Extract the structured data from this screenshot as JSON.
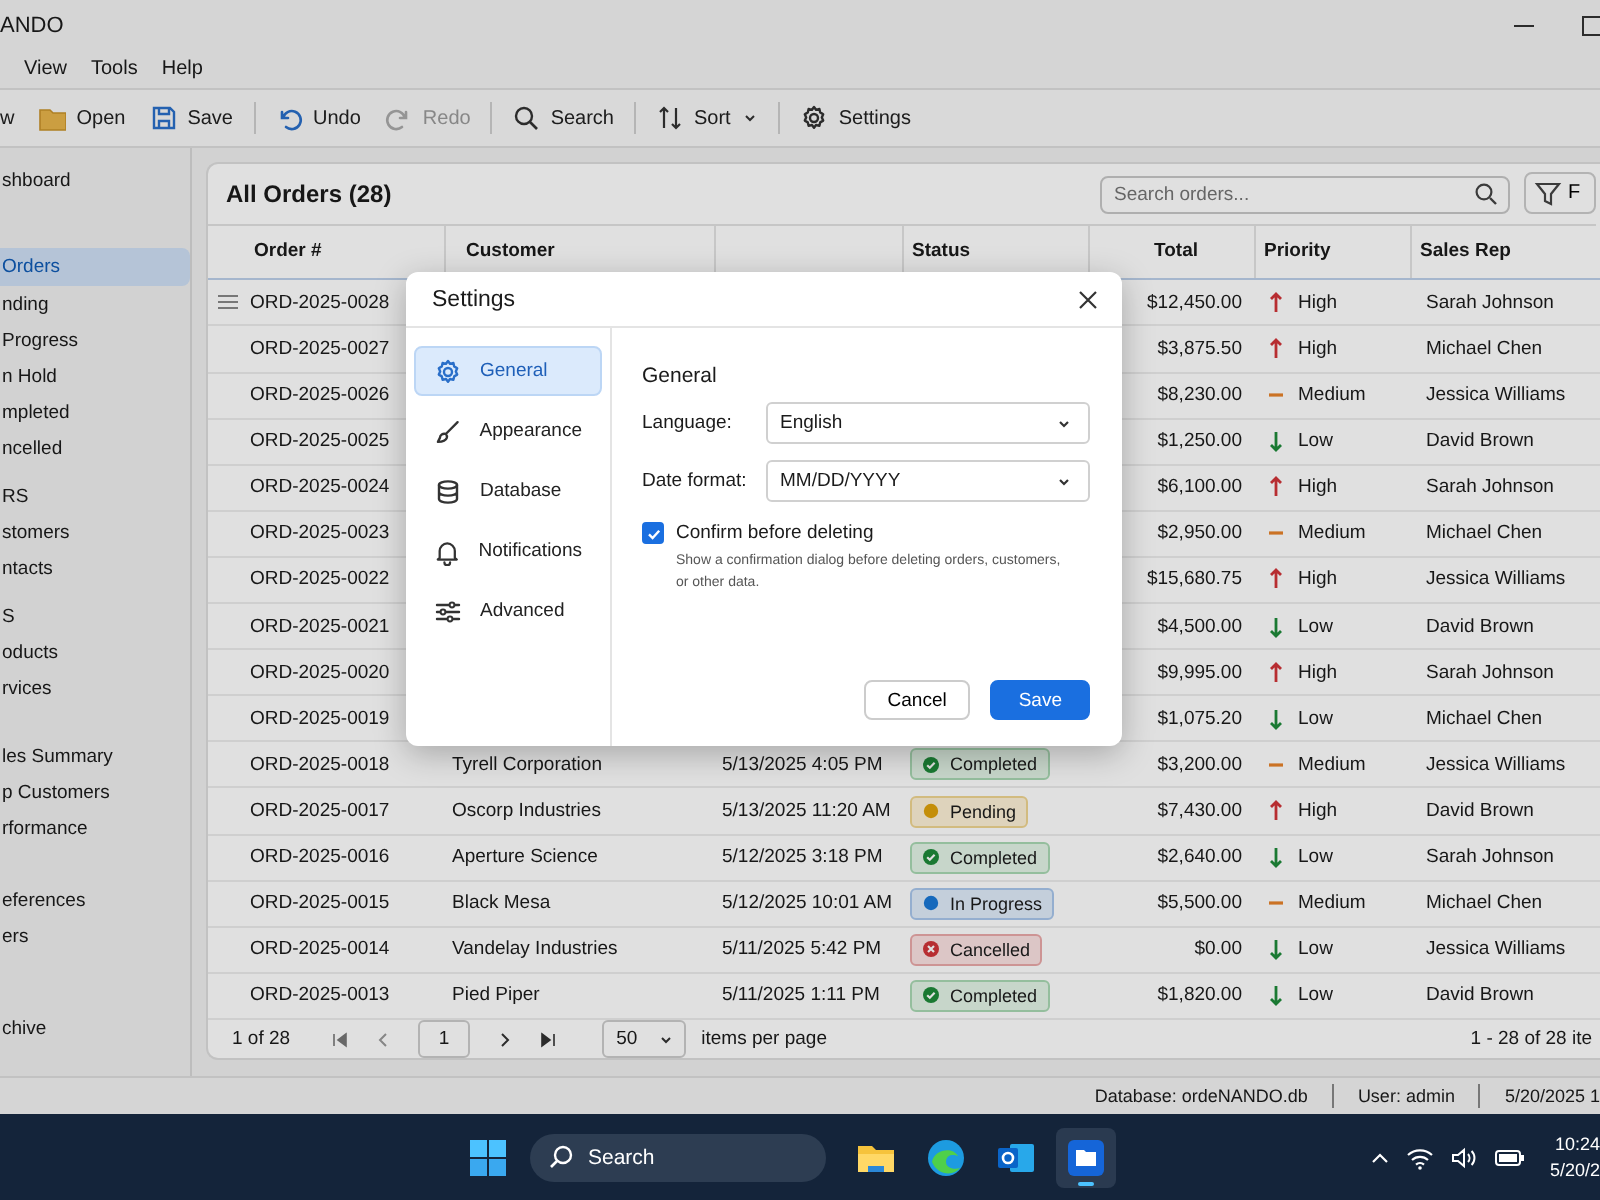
{
  "window": {
    "title": "ANDO"
  },
  "menu": [
    "View",
    "Tools",
    "Help"
  ],
  "toolbar": [
    {
      "items": [
        {
          "label": "w",
          "disabled": false
        },
        {
          "label": "Open",
          "disabled": false
        },
        {
          "label": "Save",
          "disabled": false
        }
      ]
    },
    {
      "items": [
        {
          "label": "Undo",
          "disabled": false
        },
        {
          "label": "Redo",
          "disabled": true
        }
      ]
    },
    {
      "items": [
        {
          "label": "Search",
          "disabled": false
        }
      ]
    },
    {
      "items": [
        {
          "label": "Sort",
          "disabled": false,
          "has_menu": true
        }
      ]
    },
    {
      "items": [
        {
          "label": "Settings",
          "disabled": false
        }
      ]
    }
  ],
  "sidebar": {
    "groups": [
      {
        "items": [
          {
            "label": "shboard",
            "selected": false
          }
        ]
      },
      {
        "items": [
          {
            "label": "Orders",
            "selected": true
          },
          {
            "label": "nding",
            "selected": false
          },
          {
            "label": "Progress",
            "selected": false
          },
          {
            "label": "n Hold",
            "selected": false
          },
          {
            "label": "mpleted",
            "selected": false
          },
          {
            "label": "ncelled",
            "selected": false
          }
        ]
      },
      {
        "items": [
          {
            "label": "RS",
            "selected": false
          },
          {
            "label": "stomers",
            "selected": false
          },
          {
            "label": "ntacts",
            "selected": false
          }
        ]
      },
      {
        "items": [
          {
            "label": "S",
            "selected": false
          },
          {
            "label": "oducts",
            "selected": false
          },
          {
            "label": "rvices",
            "selected": false
          }
        ]
      },
      {
        "items": [
          {
            "label": "les Summary",
            "selected": false
          },
          {
            "label": "p Customers",
            "selected": false
          },
          {
            "label": "rformance",
            "selected": false
          }
        ]
      },
      {
        "items": [
          {
            "label": "eferences",
            "selected": false
          },
          {
            "label": "ers",
            "selected": false
          }
        ]
      },
      {
        "items": [
          {
            "label": "chive",
            "selected": false
          }
        ]
      }
    ]
  },
  "orders": {
    "title": "All Orders (28)",
    "search": {
      "placeholder": "Search orders..."
    },
    "filter_label": "F",
    "header": {
      "order": "Order #",
      "customer": "Customer",
      "status": "Status",
      "total": "Total",
      "priority": "Priority",
      "rep": "Sales Rep"
    },
    "rows": [
      {
        "order": "ORD-2025-0028",
        "show_handle": true,
        "total": "$12,450.00",
        "priority": {
          "label": "High",
          "kind": "high"
        },
        "rep": "Sarah Johnson"
      },
      {
        "order": "ORD-2025-0027",
        "show_handle": false,
        "total": "$3,875.50",
        "priority": {
          "label": "High",
          "kind": "high"
        },
        "rep": "Michael Chen"
      },
      {
        "order": "ORD-2025-0026",
        "show_handle": false,
        "total": "$8,230.00",
        "priority": {
          "label": "Medium",
          "kind": "medium"
        },
        "rep": "Jessica Williams"
      },
      {
        "order": "ORD-2025-0025",
        "show_handle": false,
        "total": "$1,250.00",
        "priority": {
          "label": "Low",
          "kind": "low"
        },
        "rep": "David Brown"
      },
      {
        "order": "ORD-2025-0024",
        "show_handle": false,
        "total": "$6,100.00",
        "priority": {
          "label": "High",
          "kind": "high"
        },
        "rep": "Sarah Johnson"
      },
      {
        "order": "ORD-2025-0023",
        "show_handle": false,
        "total": "$2,950.00",
        "priority": {
          "label": "Medium",
          "kind": "medium"
        },
        "rep": "Michael Chen"
      },
      {
        "order": "ORD-2025-0022",
        "show_handle": false,
        "total": "$15,680.75",
        "priority": {
          "label": "High",
          "kind": "high"
        },
        "rep": "Jessica Williams"
      },
      {
        "order": "ORD-2025-0021",
        "show_handle": false,
        "total": "$4,500.00",
        "priority": {
          "label": "Low",
          "kind": "low"
        },
        "rep": "David Brown"
      },
      {
        "order": "ORD-2025-0020",
        "show_handle": false,
        "total": "$9,995.00",
        "priority": {
          "label": "High",
          "kind": "high"
        },
        "rep": "Sarah Johnson"
      },
      {
        "order": "ORD-2025-0019",
        "show_handle": false,
        "total": "$1,075.20",
        "priority": {
          "label": "Low",
          "kind": "low"
        },
        "rep": "Michael Chen"
      },
      {
        "order": "ORD-2025-0018",
        "show_handle": false,
        "customer": "Tyrell Corporation",
        "date": "5/13/2025 4:05 PM",
        "status": {
          "label": "Completed",
          "kind": "completed"
        },
        "total": "$3,200.00",
        "priority": {
          "label": "Medium",
          "kind": "medium"
        },
        "rep": "Jessica Williams"
      },
      {
        "order": "ORD-2025-0017",
        "show_handle": false,
        "customer": "Oscorp Industries",
        "date": "5/13/2025 11:20 AM",
        "status": {
          "label": "Pending",
          "kind": "pending"
        },
        "total": "$7,430.00",
        "priority": {
          "label": "High",
          "kind": "high"
        },
        "rep": "David Brown"
      },
      {
        "order": "ORD-2025-0016",
        "show_handle": false,
        "customer": "Aperture Science",
        "date": "5/12/2025 3:18 PM",
        "status": {
          "label": "Completed",
          "kind": "completed"
        },
        "total": "$2,640.00",
        "priority": {
          "label": "Low",
          "kind": "low"
        },
        "rep": "Sarah Johnson"
      },
      {
        "order": "ORD-2025-0015",
        "show_handle": false,
        "customer": "Black Mesa",
        "date": "5/12/2025 10:01 AM",
        "status": {
          "label": "In Progress",
          "kind": "progress"
        },
        "total": "$5,500.00",
        "priority": {
          "label": "Medium",
          "kind": "medium"
        },
        "rep": "Michael Chen"
      },
      {
        "order": "ORD-2025-0014",
        "show_handle": false,
        "customer": "Vandelay Industries",
        "date": "5/11/2025 5:42 PM",
        "status": {
          "label": "Cancelled",
          "kind": "cancelled"
        },
        "total": "$0.00",
        "priority": {
          "label": "Low",
          "kind": "low"
        },
        "rep": "Jessica Williams"
      },
      {
        "order": "ORD-2025-0013",
        "show_handle": false,
        "customer": "Pied Piper",
        "date": "5/11/2025 1:11 PM",
        "status": {
          "label": "Completed",
          "kind": "completed"
        },
        "total": "$1,820.00",
        "priority": {
          "label": "Low",
          "kind": "low"
        },
        "rep": "David Brown"
      }
    ],
    "pagination": {
      "position": "1 of 28",
      "page": "1",
      "per_page": "50",
      "per_page_label": "items per page",
      "range": "1 - 28 of 28 ite"
    }
  },
  "status_bar": [
    "Database: ordeNANDO.db",
    "User: admin",
    "5/20/2025 1"
  ],
  "dialog": {
    "title": "Settings",
    "nav": [
      {
        "label": "General",
        "selected": true
      },
      {
        "label": "Appearance",
        "selected": false
      },
      {
        "label": "Database",
        "selected": false
      },
      {
        "label": "Notifications",
        "selected": false
      },
      {
        "label": "Advanced",
        "selected": false
      }
    ],
    "heading": "General",
    "fields": [
      {
        "label": "Language:",
        "value": "English"
      },
      {
        "label": "Date format:",
        "value": "MM/DD/YYYY"
      }
    ],
    "confirm": {
      "label": "Confirm before deleting",
      "checked": true,
      "description": "Show a confirmation dialog before deleting orders, customers, or other data."
    },
    "buttons": [
      {
        "label": "Cancel",
        "kind": "secondary"
      },
      {
        "label": "Save",
        "kind": "primary"
      }
    ]
  },
  "taskbar": {
    "search": "Search",
    "apps": [
      {
        "selected": false
      },
      {
        "selected": false
      },
      {
        "selected": false
      },
      {
        "selected": true
      }
    ],
    "time": "10:24",
    "date": "5/20/2"
  }
}
